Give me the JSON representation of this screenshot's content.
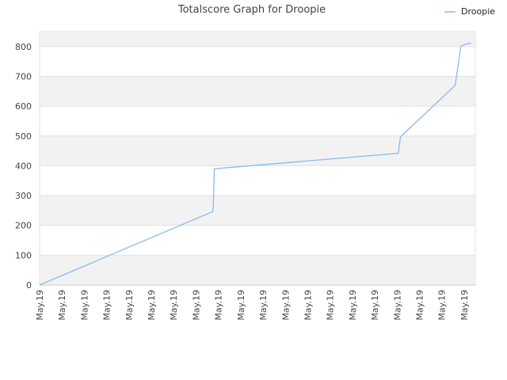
{
  "chart_data": {
    "type": "line",
    "title": "Totalscore Graph for Droopie",
    "xlabel": "",
    "ylabel": "",
    "ylim": [
      0,
      850
    ],
    "yticks": [
      0,
      100,
      200,
      300,
      400,
      500,
      600,
      700,
      800
    ],
    "ytick_labels": [
      "0",
      "100",
      "200",
      "300",
      "400",
      "500",
      "600",
      "700",
      "800"
    ],
    "xlim": [
      0,
      19.5
    ],
    "xtick_positions": [
      0,
      1,
      2,
      3,
      4,
      5,
      6,
      7,
      8,
      9,
      10,
      11,
      12,
      13,
      14,
      15,
      16,
      17,
      18,
      19
    ],
    "xtick_labels": [
      "May.19",
      "May.19",
      "May.19",
      "May.19",
      "May.19",
      "May.19",
      "May.19",
      "May.19",
      "May.19",
      "May.19",
      "May.19",
      "May.19",
      "May.19",
      "May.19",
      "May.19",
      "May.19",
      "May.19",
      "May.19",
      "May.19",
      "May.19"
    ],
    "grid": true,
    "legend_position": "top-right",
    "series": [
      {
        "name": "Droopie",
        "color": "#88bbee",
        "x": [
          0,
          7.74,
          7.77,
          7.82,
          16.05,
          16.15,
          18.6,
          18.85,
          18.95,
          19.3
        ],
        "y": [
          0,
          246,
          260,
          390,
          442,
          497,
          670,
          800,
          805,
          812
        ]
      }
    ]
  }
}
